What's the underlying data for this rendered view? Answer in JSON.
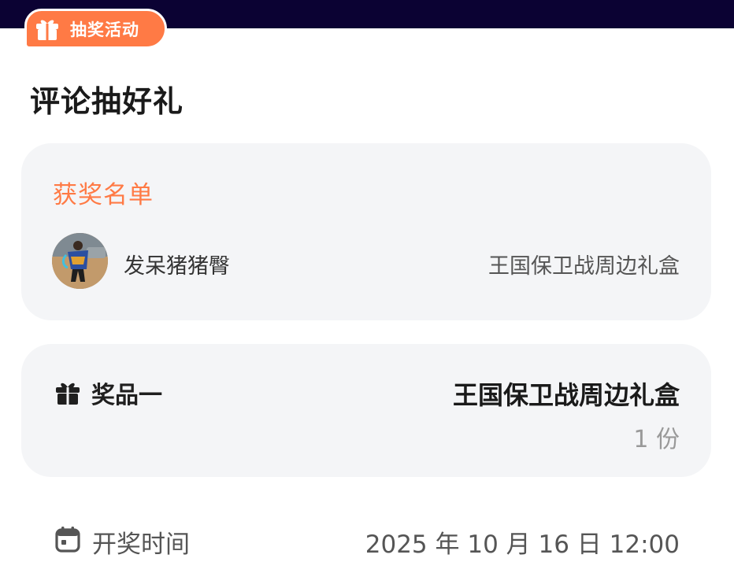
{
  "badge": {
    "label": "抽奖活动",
    "icon": "gift-box-icon"
  },
  "page_title": "评论抽好礼",
  "winners": {
    "title": "获奖名单",
    "items": [
      {
        "name": "发呆猪猪臀",
        "prize": "王国保卫战周边礼盒",
        "avatar": "user-avatar"
      }
    ]
  },
  "prize": {
    "label": "奖品一",
    "icon": "gift-icon",
    "name": "王国保卫战周边礼盒",
    "count": "1 份"
  },
  "draw_time": {
    "label": "开奖时间",
    "icon": "calendar-icon",
    "value": "2025 年 10 月 16 日 12:00"
  },
  "colors": {
    "accent": "#ff7a45",
    "top_band": "#0b0233",
    "card_bg": "#f4f5f7",
    "muted_text": "#999999"
  }
}
